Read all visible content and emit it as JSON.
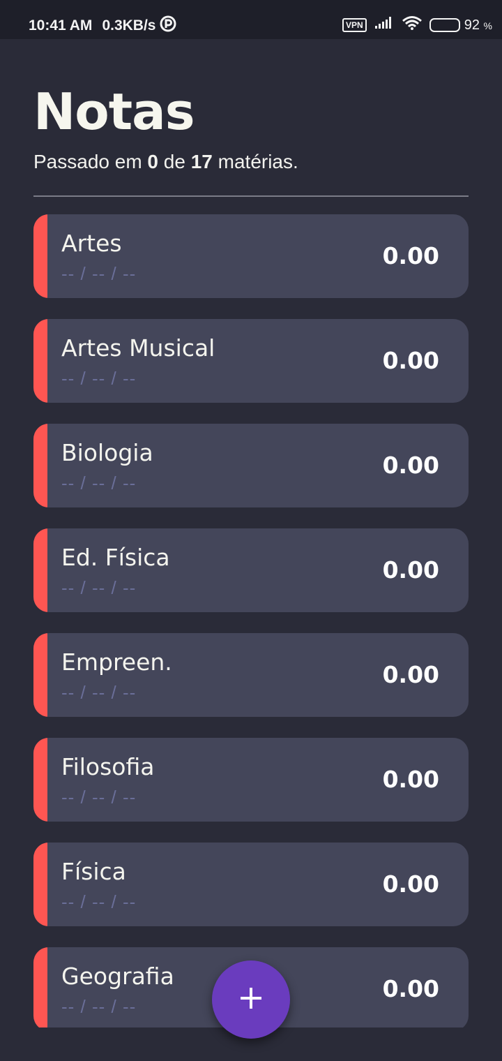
{
  "status_bar": {
    "time": "10:41 AM",
    "speed": "0.3KB/s",
    "vpn": "VPN",
    "battery_pct": "92",
    "battery_unit": "%"
  },
  "header": {
    "title": "Notas",
    "subtitle_prefix": "Passado em ",
    "passed": "0",
    "subtitle_middle": " de ",
    "total": "17",
    "subtitle_suffix": " matérias."
  },
  "subjects": [
    {
      "name": "Artes",
      "grades": "-- / -- / --",
      "score": "0.00"
    },
    {
      "name": "Artes Musical",
      "grades": "-- / -- / --",
      "score": "0.00"
    },
    {
      "name": "Biologia",
      "grades": "-- / -- / --",
      "score": "0.00"
    },
    {
      "name": "Ed. Física",
      "grades": "-- / -- / --",
      "score": "0.00"
    },
    {
      "name": "Empreen.",
      "grades": "-- / -- / --",
      "score": "0.00"
    },
    {
      "name": "Filosofia",
      "grades": "-- / -- / --",
      "score": "0.00"
    },
    {
      "name": "Física",
      "grades": "-- / -- / --",
      "score": "0.00"
    },
    {
      "name": "Geografia",
      "grades": "-- / -- / --",
      "score": "0.00"
    }
  ],
  "fab": {
    "icon": "plus-icon"
  },
  "colors": {
    "background": "#2a2b38",
    "card": "#44465a",
    "failing_accent": "#ff5652",
    "fab": "#6a3cbe"
  }
}
